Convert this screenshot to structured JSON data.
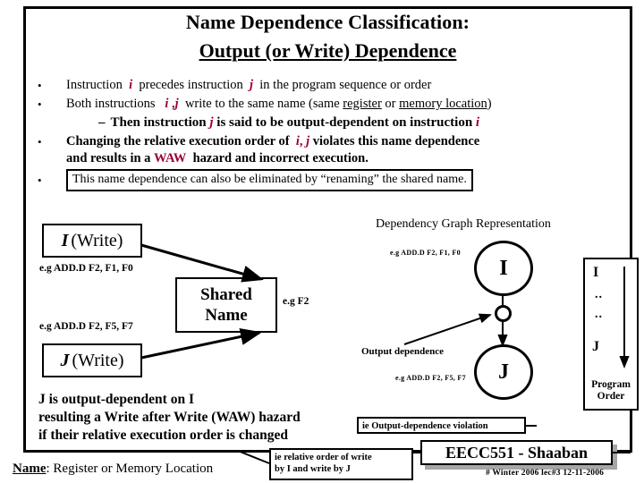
{
  "slide": {
    "title_line1": "Name Dependence Classification:",
    "title_line2": "Output (or Write) Dependence"
  },
  "bullets": {
    "b1": {
      "marker": "•",
      "pre": "Instruction",
      "sym_i": "i",
      "mid": "precedes instruction",
      "sym_j": "j",
      "post": "in the program sequence or order"
    },
    "b2": {
      "marker": "•",
      "pre": "Both instructions",
      "sym_i": "i",
      "comma": ",",
      "sym_j": "j",
      "mid": "write to the same name (same",
      "ul1": "register",
      "or": "or",
      "ul2": "memory location",
      "post": ")"
    },
    "sub": {
      "dash": "–",
      "pre": "Then instruction",
      "sym_j": "j",
      "mid": "is said to be output-dependent on instruction",
      "sym_i": "i"
    },
    "b3": {
      "marker": "•",
      "pre": "Changing the relative execution order of",
      "sym_i": "i",
      "comma": ",",
      "sym_j": "j",
      "post": "violates this name dependence",
      "line2_pre": "and results in a",
      "waw": "WAW",
      "line2_post": "hazard and incorrect execution."
    },
    "b4": {
      "marker": "•",
      "text": "This name dependence can also be eliminated by “renaming” the shared name."
    }
  },
  "block_diagram": {
    "box_i_sym": "I",
    "box_i_rest": "(Write)",
    "box_j_sym": "J",
    "box_j_rest": "(Write)",
    "shared_line1": "Shared",
    "shared_line2": "Name",
    "eg_i": "e.g  ADD.D  F2, F1, F0",
    "eg_j": "e.g  ADD.D  F2, F5, F7",
    "eg_f2": "e.g F2"
  },
  "dep_graph": {
    "title": "Dependency Graph Representation",
    "node_i": "I",
    "node_j": "J",
    "eg_i": "e.g  ADD.D  F2, F1, F0",
    "eg_j": "e.g  ADD.D  F2, F5, F7",
    "edge_label": "Output dependence"
  },
  "program_order": {
    "top": "I",
    "dots1": "..",
    "dots2": "..",
    "bottom": "J",
    "caption_line1": "Program",
    "caption_line2": "Order"
  },
  "conclusion": {
    "line1": "J is output-dependent on I",
    "line2": "resulting a Write after Write  (WAW) hazard",
    "line3": "if their relative execution order is changed"
  },
  "name_line": {
    "label": "Name",
    "rest": ": Register  or  Memory Location"
  },
  "annotations": {
    "violation": "ie Output-dependence violation",
    "relative_line1": "ie relative order of write",
    "relative_line2": "by I and write by J"
  },
  "footer": {
    "course": "EECC551 - Shaaban",
    "note": "# Winter 2006  lec#3    12-11-2006"
  },
  "colors": {
    "accent_red": "#990033",
    "ink": "#000000",
    "paper": "#ffffff",
    "shadow": "#a6a6a6"
  }
}
